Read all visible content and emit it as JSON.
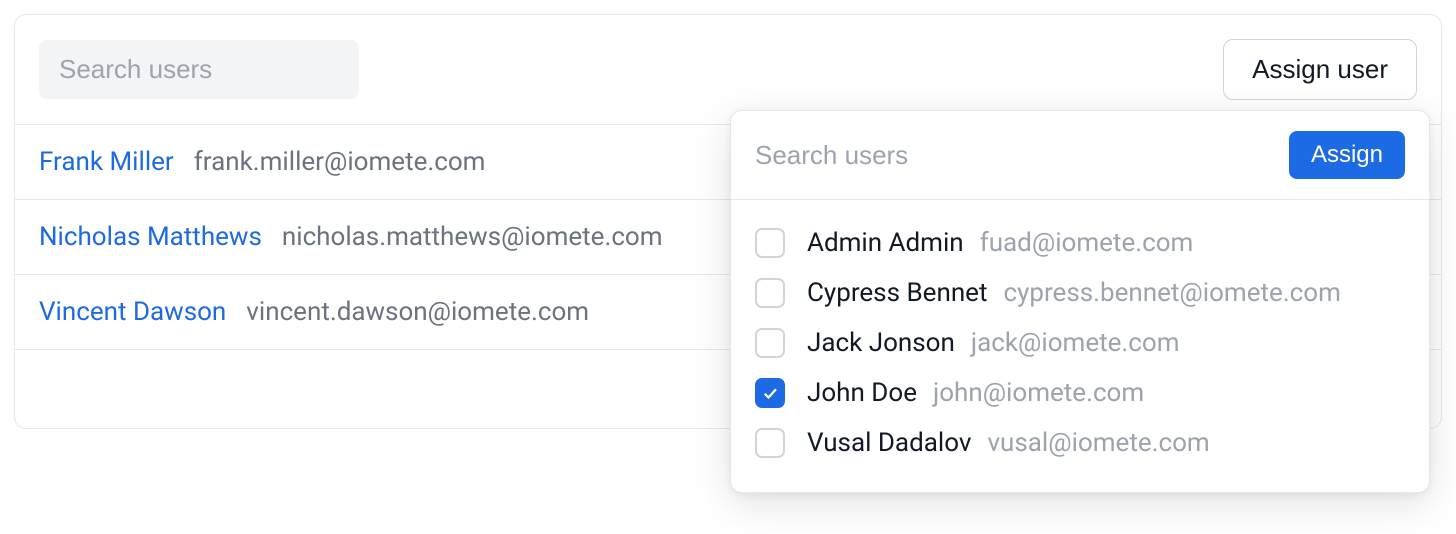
{
  "colors": {
    "accent": "#1d6ae5",
    "muted": "#6b7280",
    "border": "#e5e7eb"
  },
  "panel": {
    "search_placeholder": "Search users",
    "assign_user_label": "Assign user"
  },
  "users": [
    {
      "name": "Frank Miller",
      "email": "frank.miller@iomete.com"
    },
    {
      "name": "Nicholas Matthews",
      "email": "nicholas.matthews@iomete.com"
    },
    {
      "name": "Vincent Dawson",
      "email": "vincent.dawson@iomete.com"
    }
  ],
  "popover": {
    "search_placeholder": "Search users",
    "assign_label": "Assign",
    "options": [
      {
        "name": "Admin Admin",
        "email": "fuad@iomete.com",
        "checked": false
      },
      {
        "name": "Cypress Bennet",
        "email": "cypress.bennet@iomete.com",
        "checked": false
      },
      {
        "name": "Jack Jonson",
        "email": "jack@iomete.com",
        "checked": false
      },
      {
        "name": "John Doe",
        "email": "john@iomete.com",
        "checked": true
      },
      {
        "name": "Vusal Dadalov",
        "email": "vusal@iomete.com",
        "checked": false
      }
    ]
  }
}
